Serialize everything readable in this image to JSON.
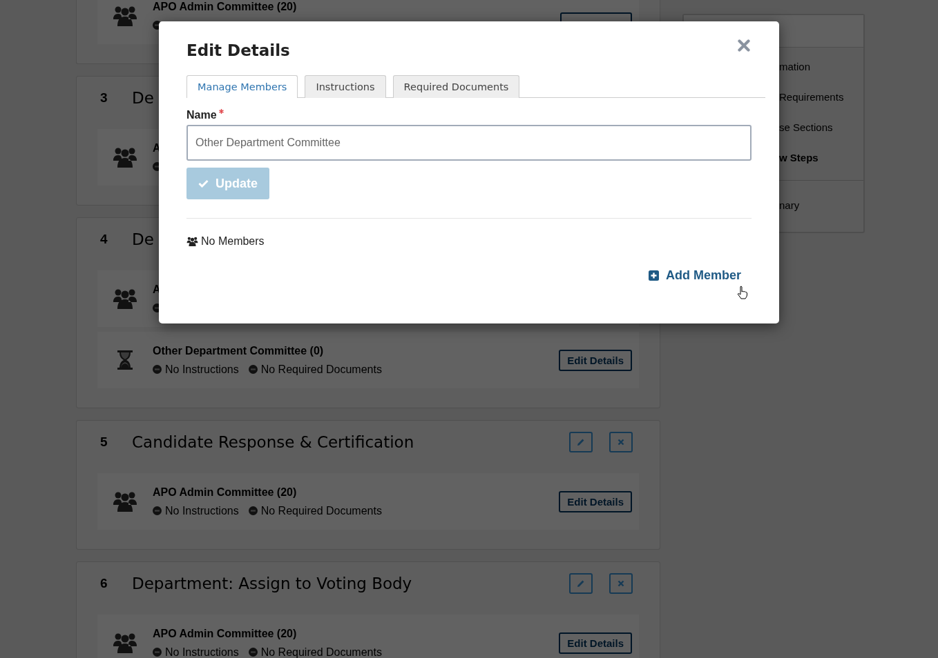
{
  "sections": [
    {
      "groups": [
        {
          "kind": "group",
          "name": "APO Admin Committee (20)",
          "cut": true,
          "button_covered": true
        }
      ]
    },
    {
      "number": "3",
      "title": "De",
      "groups": [
        {
          "kind": "group",
          "name": "A",
          "cut": true
        }
      ]
    },
    {
      "number": "4",
      "title": "De",
      "groups": [
        {
          "kind": "group",
          "name": "A",
          "cut": true
        },
        {
          "kind": "pending",
          "name": "Other Department Committee (0)",
          "statuses": [
            "No Instructions",
            "No Required Documents"
          ],
          "button": "Edit Details"
        }
      ]
    },
    {
      "number": "5",
      "title": "Candidate Response & Certification",
      "actions": true,
      "groups": [
        {
          "kind": "group",
          "name": "APO Admin Committee (20)",
          "statuses": [
            "No Instructions",
            "No Required Documents"
          ],
          "button": "Edit Details"
        }
      ]
    },
    {
      "number": "6",
      "title": "Department: Assign to Voting Body",
      "actions": true,
      "groups": [
        {
          "kind": "group",
          "name": "APO Admin Committee (20)",
          "statuses": [
            "No Instructions",
            "No Required Documents"
          ],
          "button": "Edit Details"
        }
      ]
    }
  ],
  "sidebar": {
    "items": [
      {
        "label": "mation",
        "selected": false
      },
      {
        "label": "Requirements",
        "selected": false
      },
      {
        "label": "se Sections",
        "selected": false
      },
      {
        "label": "w Steps",
        "selected": true
      }
    ],
    "footer_items": [
      {
        "label": "nary",
        "selected": false
      }
    ]
  },
  "modal": {
    "title": "Edit Details",
    "tabs": [
      {
        "label": "Manage Members",
        "selected": true
      },
      {
        "label": "Instructions",
        "selected": false
      },
      {
        "label": "Required Documents",
        "selected": false
      }
    ],
    "name_field": {
      "label": "Name",
      "required": true,
      "value": "Other Department Committee"
    },
    "update_button": {
      "label": "Update",
      "disabled": true
    },
    "members_text": "No Members",
    "add_member": "Add Member"
  }
}
